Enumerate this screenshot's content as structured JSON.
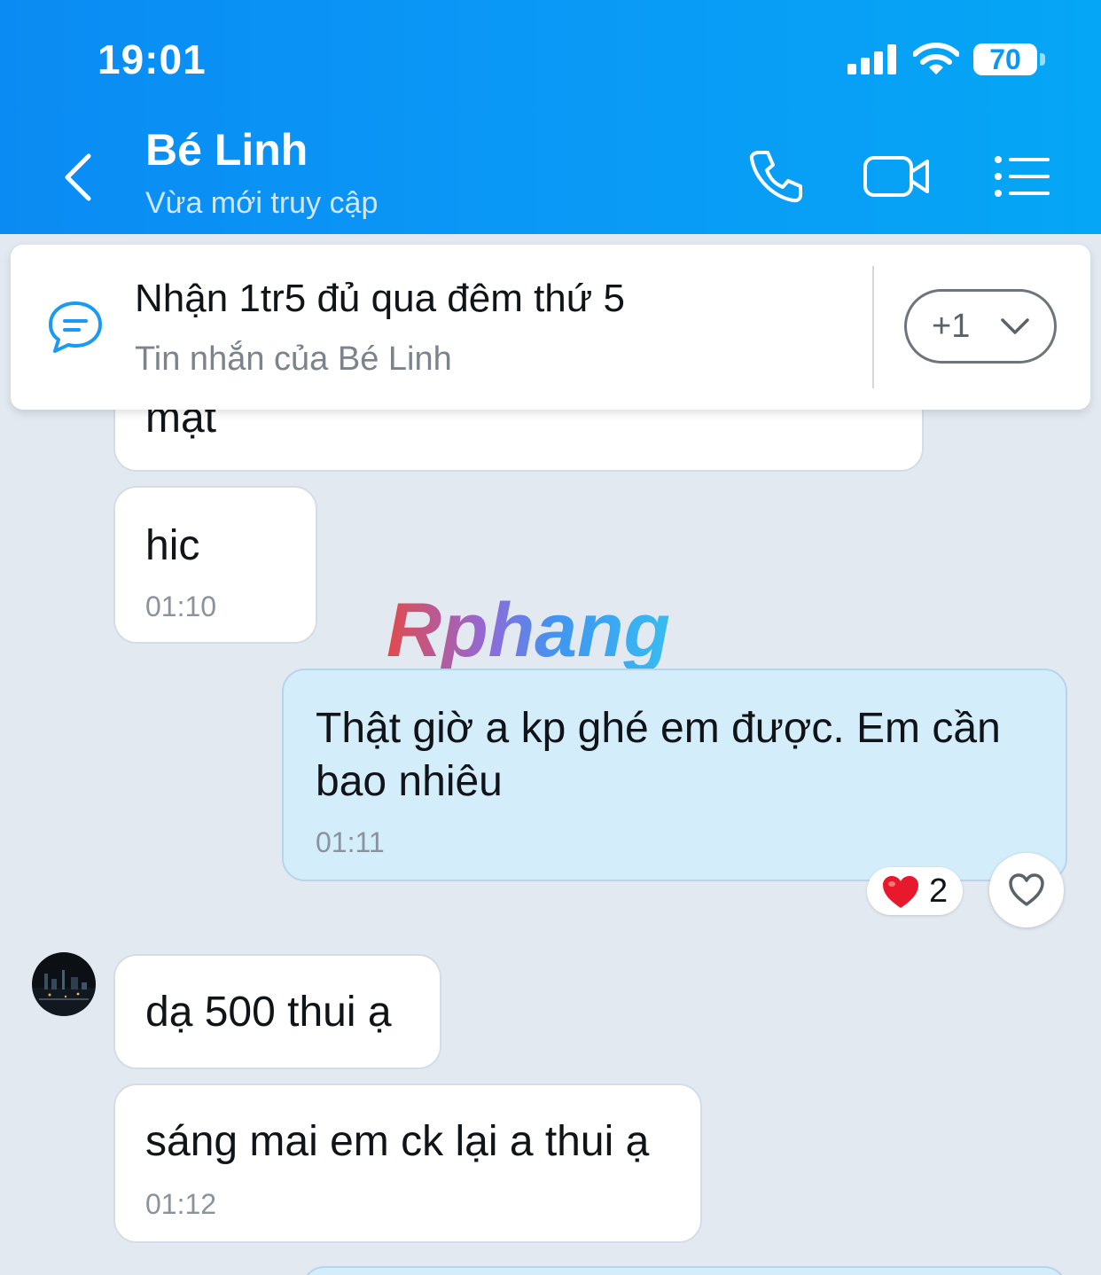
{
  "status_bar": {
    "time": "19:01",
    "battery": "70"
  },
  "header": {
    "name": "Bé Linh",
    "status": "Vừa mới truy cập"
  },
  "pinned": {
    "title": "Nhận 1tr5 đủ qua đêm thứ 5",
    "subtitle": "Tin nhắn của Bé Linh",
    "more": "+1"
  },
  "messages": [
    {
      "dir": "in",
      "text": "mặt"
    },
    {
      "dir": "in",
      "text": "hic",
      "time": "01:10"
    },
    {
      "dir": "out",
      "text_line1": "Thật giờ a kp ghé em được. Em cần",
      "text_line2": "bao nhiêu",
      "time": "01:11"
    },
    {
      "dir": "in",
      "text": "dạ 500 thui ạ"
    },
    {
      "dir": "in",
      "text": "sáng mai em ck lại a thui ạ",
      "time": "01:12"
    }
  ],
  "reaction": {
    "emoji": "heart",
    "count": "2"
  },
  "watermark": "Rphang",
  "colors": {
    "header": "#0a99f6",
    "outgoing_bubble": "#d4edfb",
    "background": "#e3e9f1",
    "accent": "#1a9af5"
  }
}
